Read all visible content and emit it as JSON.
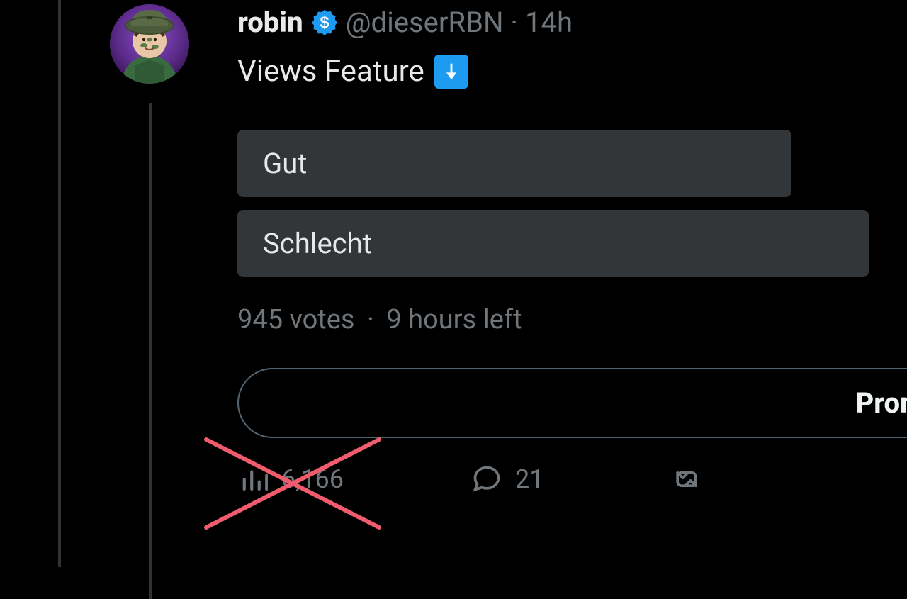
{
  "tweet": {
    "display_name": "robin",
    "handle": "@dieserRBN",
    "separator": "·",
    "time": "14h",
    "text": "Views Feature",
    "verified_dollar": true
  },
  "poll": {
    "options": [
      {
        "label": "Gut"
      },
      {
        "label": "Schlecht"
      }
    ],
    "votes_text": "945 votes",
    "separator": "·",
    "time_left": "9 hours left"
  },
  "promote": {
    "label": "Promote"
  },
  "actions": {
    "views": "6,166",
    "replies": "21"
  },
  "colors": {
    "accent": "#1d9bf0",
    "annotation": "#f05c6e"
  }
}
